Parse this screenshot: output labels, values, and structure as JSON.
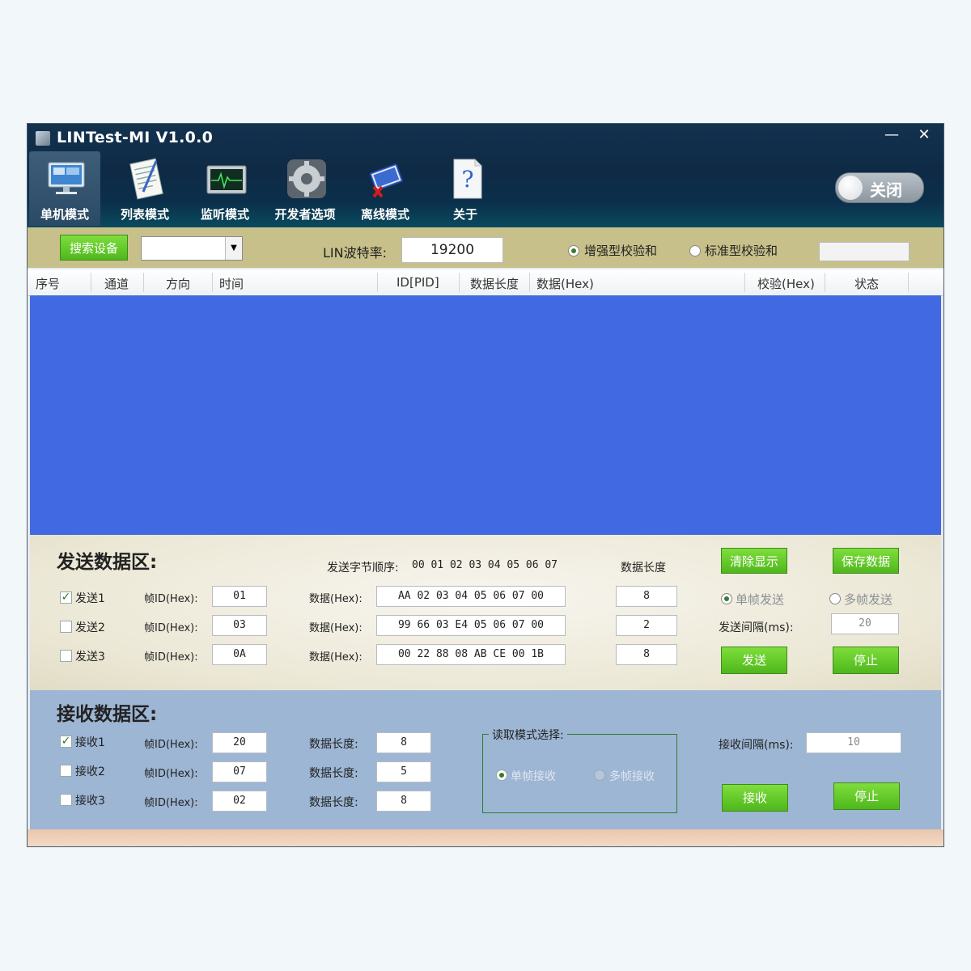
{
  "window": {
    "title": "LINTest-MI V1.0.0",
    "minimize": "—",
    "close": "✕"
  },
  "toolbar": {
    "items": [
      {
        "label": "单机模式",
        "icon": "monitor-icon"
      },
      {
        "label": "列表模式",
        "icon": "notepad-icon"
      },
      {
        "label": "监听模式",
        "icon": "oscilloscope-icon"
      },
      {
        "label": "开发者选项",
        "icon": "gear-icon"
      },
      {
        "label": "离线模式",
        "icon": "book-icon"
      },
      {
        "label": "关于",
        "icon": "question-icon"
      }
    ],
    "toggle_label": "关闭"
  },
  "controls": {
    "search_label": "搜索设备",
    "baud_label": "LIN波特率:",
    "baud_value": "19200",
    "enhanced_checksum": "增强型校验和",
    "standard_checksum": "标准型校验和"
  },
  "table": {
    "headers": [
      "序号",
      "通道",
      "方向",
      "时间",
      "ID[PID]",
      "数据长度",
      "数据(Hex)",
      "校验(Hex)",
      "状态"
    ],
    "background": "#4169e1"
  },
  "send": {
    "title": "发送数据区:",
    "byte_order_label": "发送字节顺序:",
    "byte_order": "00 01 02 03 04 05 06 07",
    "length_header": "数据长度",
    "rows": [
      {
        "label": "发送1",
        "checked": true,
        "frame_label": "帧ID(Hex):",
        "frame_id": "01",
        "data_label": "数据(Hex):",
        "data": "AA 02 03 04 05 06 07 00",
        "length": "8"
      },
      {
        "label": "发送2",
        "checked": false,
        "frame_label": "帧ID(Hex):",
        "frame_id": "03",
        "data_label": "数据(Hex):",
        "data": "99 66 03 E4 05 06 07 00",
        "length": "2"
      },
      {
        "label": "发送3",
        "checked": false,
        "frame_label": "帧ID(Hex):",
        "frame_id": "0A",
        "data_label": "数据(Hex):",
        "data": "00 22 88 08 AB CE 00 1B",
        "length": "8"
      }
    ],
    "clear_button": "清除显示",
    "save_button": "保存数据",
    "single_frame": "单帧发送",
    "multi_frame": "多帧发送",
    "interval_label": "发送间隔(ms):",
    "interval_value": "20",
    "send_button": "发送",
    "stop_button": "停止"
  },
  "receive": {
    "title": "接收数据区:",
    "rows": [
      {
        "label": "接收1",
        "checked": true,
        "frame_label": "帧ID(Hex):",
        "frame_id": "20",
        "length_label": "数据长度:",
        "length": "8"
      },
      {
        "label": "接收2",
        "checked": false,
        "frame_label": "帧ID(Hex):",
        "frame_id": "07",
        "length_label": "数据长度:",
        "length": "5"
      },
      {
        "label": "接收3",
        "checked": false,
        "frame_label": "帧ID(Hex):",
        "frame_id": "02",
        "length_label": "数据长度:",
        "length": "8"
      }
    ],
    "mode_group_label": "读取模式选择:",
    "single_frame": "单帧接收",
    "multi_frame": "多帧接收",
    "interval_label": "接收间隔(ms):",
    "interval_value": "10",
    "receive_button": "接收",
    "stop_button": "停止"
  }
}
